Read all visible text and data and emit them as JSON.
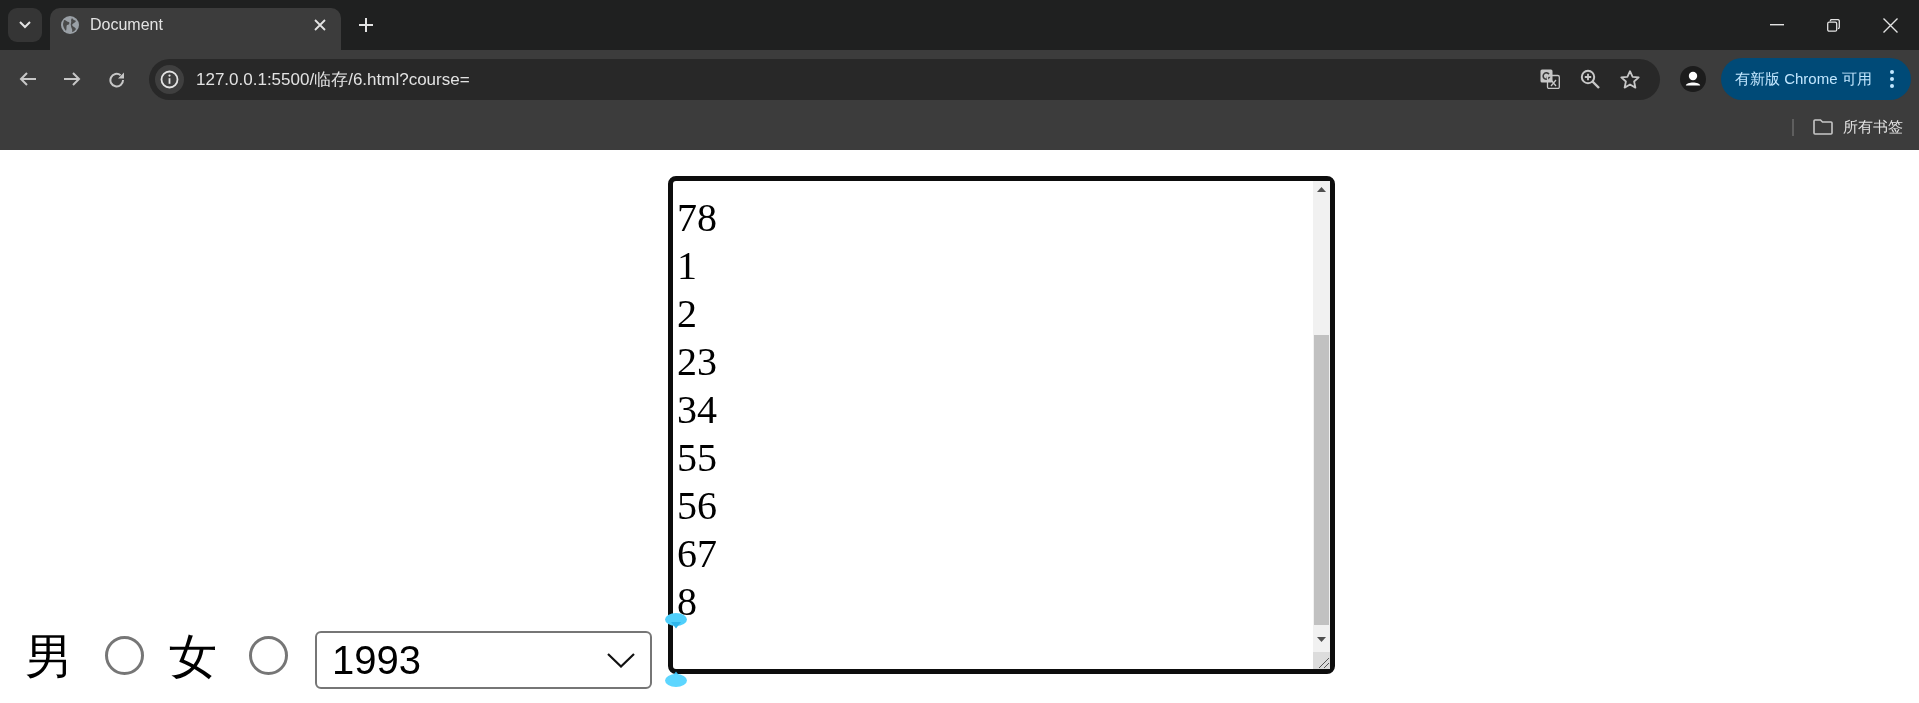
{
  "tabs": [
    {
      "title": "Document",
      "selected": true
    }
  ],
  "toolbar": {
    "url": "127.0.0.1:5500/临存/6.html?course=",
    "update_button": "有新版 Chrome 可用"
  },
  "bookmarks_bar": {
    "items": [
      {
        "label": "所有书签"
      }
    ]
  },
  "form": {
    "gender_options": [
      {
        "label": "男",
        "selected": false
      },
      {
        "label": "女",
        "selected": false
      }
    ],
    "year_select": {
      "value": "1993"
    },
    "textarea": {
      "value": "78\n1\n2\n23\n34\n55\n56\n67\n8"
    }
  }
}
